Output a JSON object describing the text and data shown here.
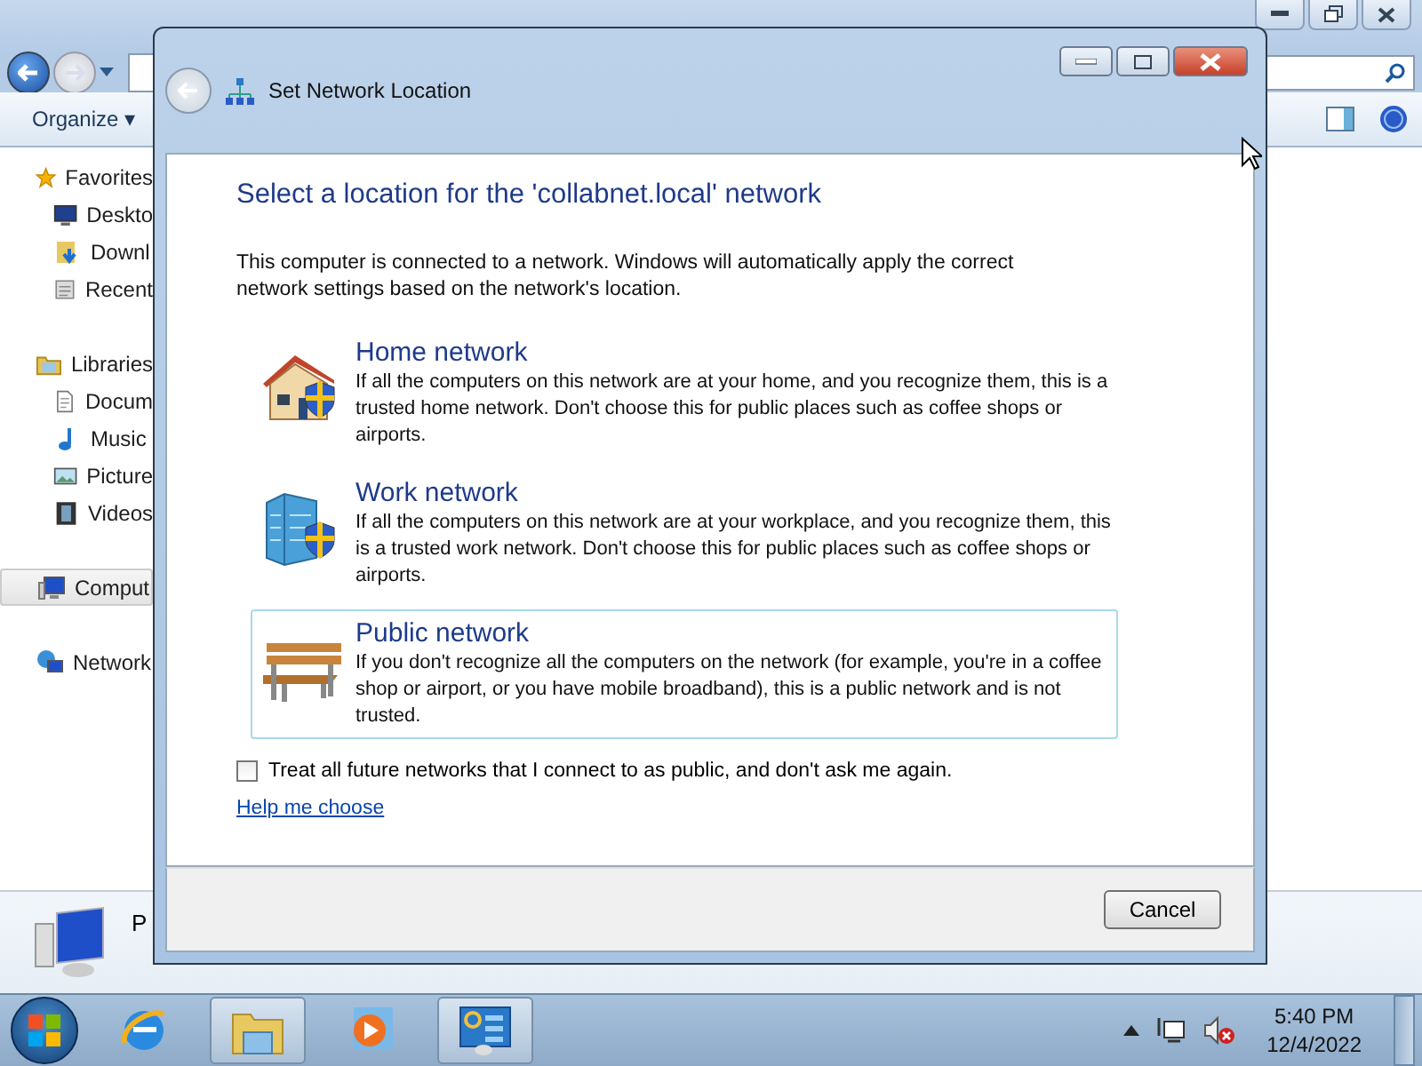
{
  "explorer": {
    "toolbar": {
      "organize": "Organize ▾"
    },
    "nav": [
      {
        "label": "Favorites",
        "kind": "star",
        "group": true,
        "selected": false
      },
      {
        "label": "Deskto",
        "kind": "desktop",
        "group": false,
        "selected": false
      },
      {
        "label": "Downl",
        "kind": "download",
        "group": false,
        "selected": false
      },
      {
        "label": "Recent",
        "kind": "recent",
        "group": false,
        "selected": false
      },
      {
        "label": "Libraries",
        "kind": "library",
        "group": true,
        "selected": false
      },
      {
        "label": "Docum",
        "kind": "document",
        "group": false,
        "selected": false
      },
      {
        "label": "Music",
        "kind": "music",
        "group": false,
        "selected": false
      },
      {
        "label": "Picture",
        "kind": "picture",
        "group": false,
        "selected": false
      },
      {
        "label": "Videos",
        "kind": "video",
        "group": false,
        "selected": false
      },
      {
        "label": "Comput",
        "kind": "computer",
        "group": true,
        "selected": true
      },
      {
        "label": "Network",
        "kind": "network",
        "group": true,
        "selected": false
      }
    ],
    "details": {
      "label": "P"
    }
  },
  "dialog": {
    "title": "Set Network Location",
    "heading": "Select a location for the 'collabnet.local' network",
    "intro": "This computer is connected to a network. Windows will automatically apply the correct network settings based on the network's location.",
    "options": [
      {
        "kind": "home",
        "title": "Home network",
        "description": "If all the computers on this network are at your home, and you recognize them, this is a trusted home network.  Don't choose this for public places such as coffee shops or airports.",
        "selected": false
      },
      {
        "kind": "work",
        "title": "Work network",
        "description": "If all the computers on this network are at your workplace, and you recognize them, this is a trusted work network.  Don't choose this for public places such as coffee shops or airports.",
        "selected": false
      },
      {
        "kind": "public",
        "title": "Public network",
        "description": "If you don't recognize all the computers on the network (for example, you're in a coffee shop or airport, or you have mobile broadband), this is a public network and is not trusted.",
        "selected": true
      }
    ],
    "checkbox": {
      "label": "Treat all future networks that I connect to as public, and don't ask me again.",
      "checked": false
    },
    "help_link": "Help me choose",
    "cancel": "Cancel"
  },
  "taskbar": {
    "apps": [
      {
        "kind": "ie",
        "active": false
      },
      {
        "kind": "folder",
        "active": true
      },
      {
        "kind": "media",
        "active": false
      },
      {
        "kind": "control",
        "active": true
      }
    ],
    "clock": {
      "time": "5:40 PM",
      "date": "12/4/2022"
    }
  }
}
